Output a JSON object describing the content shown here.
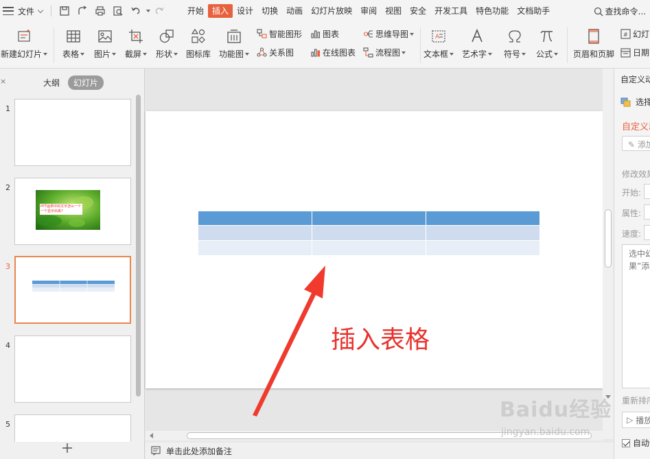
{
  "menubar": {
    "file_label": "文件",
    "tabs": [
      "开始",
      "插入",
      "设计",
      "切换",
      "动画",
      "幻灯片放映",
      "审阅",
      "视图",
      "安全",
      "开发工具",
      "特色功能",
      "文档助手"
    ],
    "active_tab": "插入",
    "search_label": "查找命令..."
  },
  "ribbon": {
    "new_slide": "新建幻灯片",
    "table": "表格",
    "picture": "图片",
    "screenshot": "截屏",
    "shape": "形状",
    "icon_lib": "图标库",
    "func_chart": "功能图",
    "smart_art": "智能图形",
    "chart": "图表",
    "mind_map": "思维导图",
    "relation": "关系图",
    "online_chart": "在线图表",
    "flowchart": "流程图",
    "textbox": "文本框",
    "wordart": "艺术字",
    "symbol": "符号",
    "formula": "公式",
    "header_footer": "页眉和页脚",
    "slide_number": "幻灯",
    "date": "日期"
  },
  "left_panel": {
    "close": "×",
    "tab_outline": "大纲",
    "tab_slides": "幻灯片",
    "thumb_1": "1",
    "thumb_2": "2",
    "thumb_3": "3",
    "thumb_4": "4",
    "thumb_5": "5",
    "thumb2_caption": "PPT图表中的文字怎么一个一个显示出来?"
  },
  "slide": {
    "annotation": "插入表格",
    "colors": {
      "header": "#5b9bd5",
      "row1": "#cfdcef",
      "row2": "#e8eef7",
      "annotation": "#e8322d"
    }
  },
  "notes": {
    "placeholder": "单击此处添加备注"
  },
  "right_panel": {
    "title": "自定义动画",
    "select_window": "选择窗格",
    "section_title": "自定义动画",
    "add_effect": "添加效果",
    "modify": "修改效果",
    "start": "开始:",
    "property": "属性:",
    "speed": "速度:",
    "desc_line1": "选中幻",
    "desc_line2": "果”添",
    "reorder": "重新排序",
    "play": "播放",
    "auto_preview": "自动预览"
  },
  "watermark": {
    "main": "Baidu经验",
    "sub": "jingyan.baidu.com"
  }
}
